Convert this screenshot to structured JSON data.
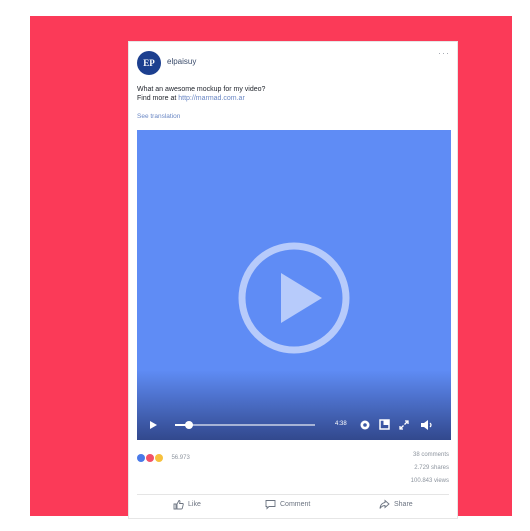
{
  "post": {
    "page_initials": "EP",
    "page_name": "elpaisuy",
    "more_label": "···",
    "caption_line1": "What an awesome mockup for my video?",
    "caption_prefix": "Find more at ",
    "caption_link": "http://marmad.com.ar",
    "see_translation": "See translation"
  },
  "video": {
    "time": "4:38",
    "progress": 0.1,
    "overlay_icon": "play-circle-icon",
    "control_icons": [
      "play-icon",
      "settings-icon",
      "popout-icon",
      "fullscreen-icon",
      "volume-icon"
    ]
  },
  "engagement": {
    "reaction_icons": [
      "like-reaction-icon",
      "love-reaction-icon",
      "haha-reaction-icon"
    ],
    "reaction_colors": [
      "#4a7ae8",
      "#f25268",
      "#f7c13d"
    ],
    "reaction_count": "56.973",
    "comments": "38 comments",
    "shares": "2.729 shares",
    "views": "100.843 views"
  },
  "actions": {
    "like": "Like",
    "comment": "Comment",
    "share": "Share"
  },
  "colors": {
    "background": "#fb3a58",
    "video": "#5f8cf5",
    "avatar": "#1c3f8f",
    "link": "#6a87c4"
  }
}
